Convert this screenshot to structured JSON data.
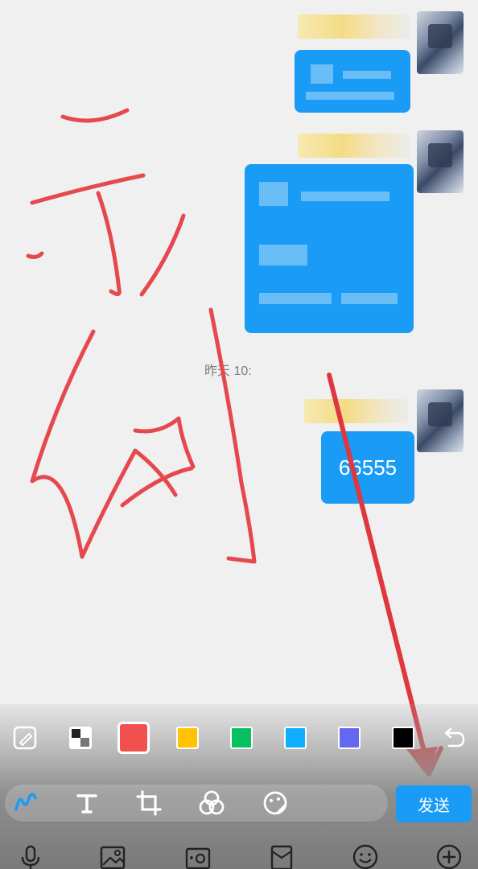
{
  "messages": {
    "timestamp": "昨天 10:",
    "last_bubble_text": "66555"
  },
  "toolbar": {
    "colors": [
      {
        "name": "red",
        "hex": "#f2504f",
        "selected": true
      },
      {
        "name": "yellow",
        "hex": "#ffc300",
        "selected": false
      },
      {
        "name": "green",
        "hex": "#07c160",
        "selected": false
      },
      {
        "name": "blue",
        "hex": "#10aeff",
        "selected": false
      },
      {
        "name": "purple",
        "hex": "#6467f0",
        "selected": false
      },
      {
        "name": "black",
        "hex": "#000000",
        "selected": false
      }
    ],
    "tools": [
      "pen-icon",
      "text-icon",
      "crop-icon",
      "mosaic-icon",
      "sticker-icon"
    ],
    "send_label": "发送"
  },
  "input_bar": {
    "icons": [
      "voice-icon",
      "album-icon",
      "camera-icon",
      "red-packet-icon",
      "emoji-icon",
      "plus-icon"
    ]
  },
  "annotation": {
    "stroke_color": "#e5484d",
    "arrow_color": "#e5484d"
  }
}
